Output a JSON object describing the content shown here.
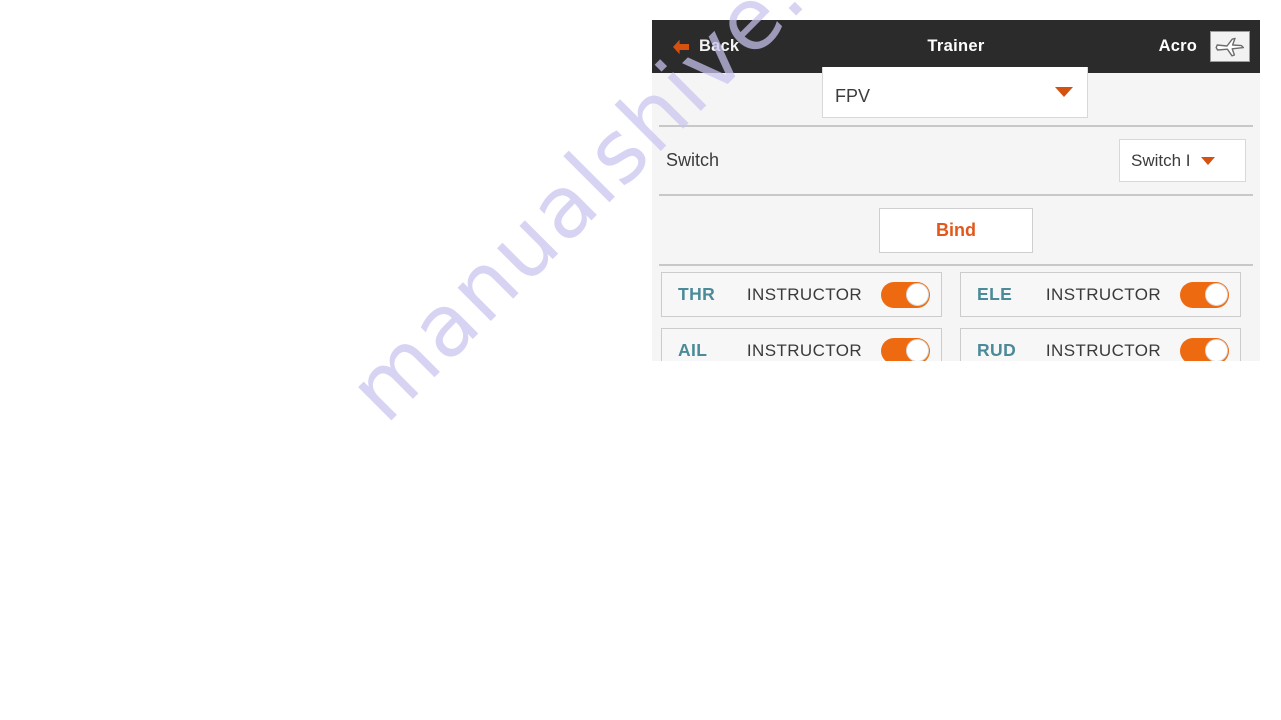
{
  "watermark": {
    "text": "manualshive.com",
    "color": "#c9c4ef"
  },
  "device": {
    "header": {
      "back_label": "Back",
      "back_icon": "arrow-left-icon",
      "title": "Trainer",
      "mode_label": "Acro",
      "model_icon": "airplane-icon"
    },
    "rows": {
      "model_dropdown": {
        "value": "FPV",
        "caret_icon": "chevron-down-icon"
      },
      "switch": {
        "label": "Switch",
        "value": "Switch I",
        "caret_icon": "chevron-down-icon"
      },
      "bind": {
        "label": "Bind"
      }
    },
    "channels": [
      {
        "name": "THR",
        "role": "INSTRUCTOR",
        "enabled": true
      },
      {
        "name": "ELE",
        "role": "INSTRUCTOR",
        "enabled": true
      },
      {
        "name": "AIL",
        "role": "INSTRUCTOR",
        "enabled": true
      },
      {
        "name": "RUD",
        "role": "INSTRUCTOR",
        "enabled": true
      }
    ],
    "colors": {
      "header_bg": "#2b2b2b",
      "accent_orange": "#e2571a",
      "toggle_on": "#ee6a10",
      "channel_label": "#4a8a99",
      "content_bg": "#f5f5f5"
    }
  }
}
